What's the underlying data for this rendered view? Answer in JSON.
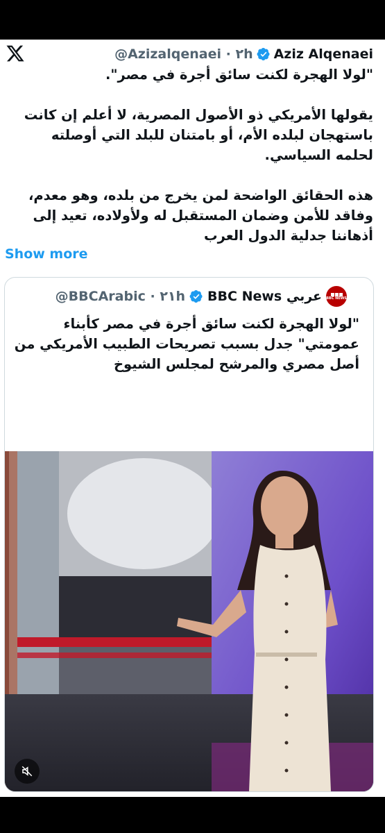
{
  "tweet": {
    "author_name": "Aziz Alqenaei",
    "handle_time": "@Azizalqenaei · ٢h",
    "paragraphs": [
      "\"لولا الهجرة لكنت سائق أجرة في مصر\".",
      "يقولها الأمريكي ذو الأصول المصرية، لا أعلم إن كانت باستهجان لبلده الأم، أو بامتنان للبلد التي أوصلته لحلمه السياسي.",
      "هذه الحقائق الواضحة لمن يخرج من بلده، وهو معدم، وفاقد للأمن وضمان المستقبل له ولأولاده، تعيد إلى أذهاننا جدلية الدول العرب"
    ],
    "show_more": "Show more"
  },
  "quote": {
    "author_name": "BBC News عربي",
    "handle_time": "@BBCArabic · ٢١h",
    "avatar_text": "BBC NEWS",
    "text": "\"لولا الهجرة لكنت سائق أجرة في مصر كأبناء عمومتي\" جدل بسبب تصريحات الطبيب الأمريكي من أصل مصري والمرشح لمجلس الشيوخ"
  },
  "icons": {
    "logo": "x-logo-icon",
    "verified": "verified-badge-icon",
    "mute": "mute-icon"
  },
  "colors": {
    "accent": "#1d9bf0",
    "verified": "#1d9bf0",
    "bbc_red": "#b80000"
  }
}
